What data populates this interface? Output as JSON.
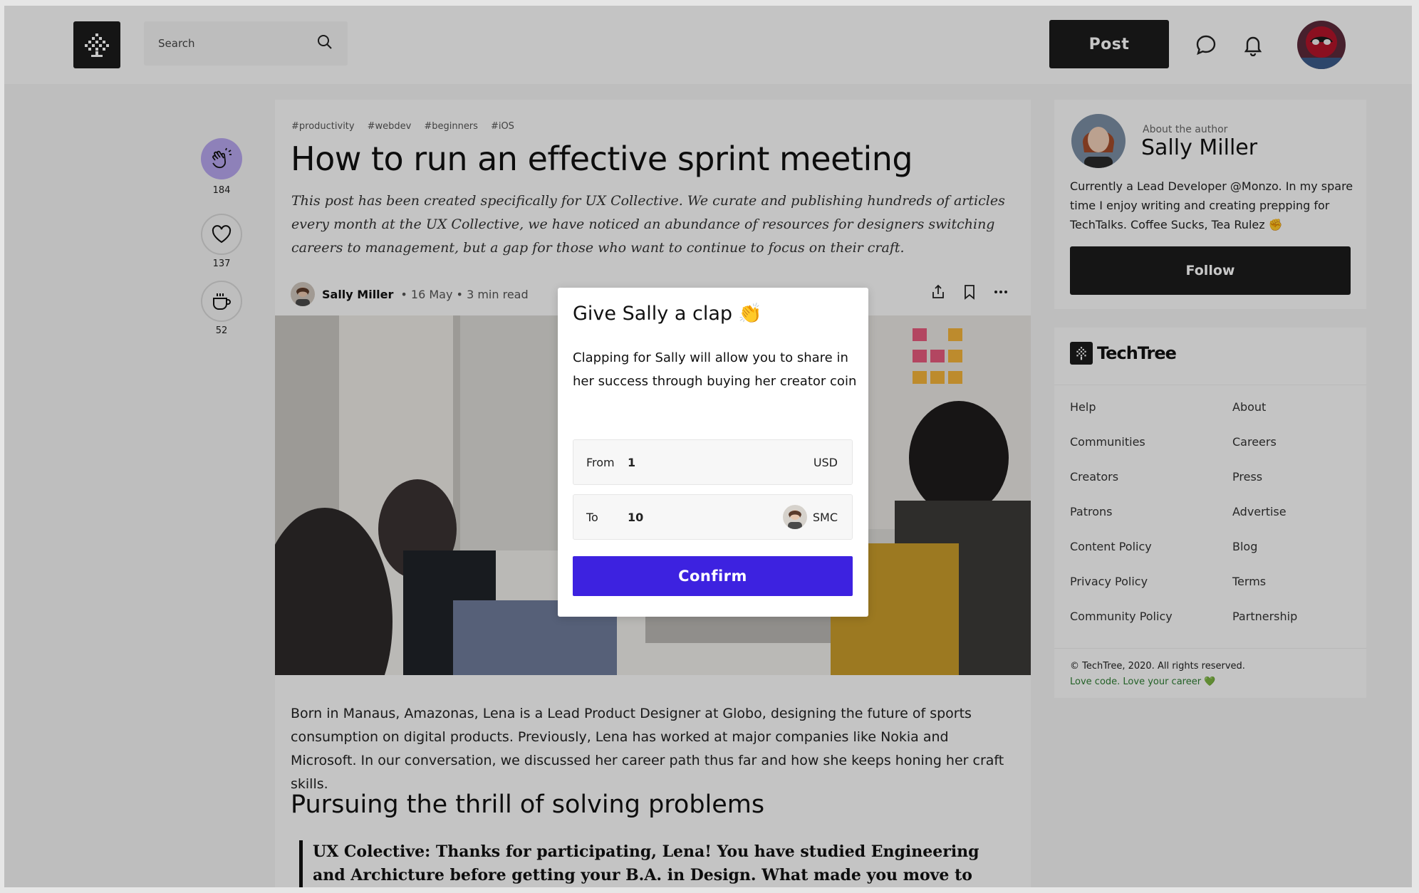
{
  "header": {
    "search_placeholder": "Search",
    "post_label": "Post",
    "icons": [
      "logo-tree-icon",
      "search-icon",
      "chat-bubble-icon",
      "bell-icon"
    ]
  },
  "rail": {
    "clap_count": "184",
    "like_count": "137",
    "coffee_count": "52"
  },
  "article": {
    "tags": [
      "#productivity",
      "#webdev",
      "#beginners",
      "#iOS"
    ],
    "title": "How to run an effective sprint meeting",
    "lede": "This post has been created specifically for UX Collective. We curate and publishing hundreds of articles every month at the UX Collective, we have noticed an abundance of resources for designers switching careers to management, but a gap for those who want to continue to focus on their craft.",
    "author": "Sally Miller",
    "meta": "• 16 May • 3 min read",
    "body": "Born in Manaus, Amazonas, Lena is a Lead Product Designer at Globo, designing the future of sports consumption on digital products. Previously, Lena has worked at major companies like Nokia and Microsoft. In our conversation, we discussed her career path thus far and how she keeps honing her craft skills.",
    "subheading": "Pursuing the thrill of solving problems",
    "quote": "UX Colective: Thanks for participating, Lena! You have studied Engineering and Archicture before getting your B.A. in Design. What made you move to design?"
  },
  "author_card": {
    "label": "About the author",
    "name": "Sally Miller",
    "bio": "Currently a Lead Developer @Monzo. In my spare time I enjoy writing and creating prepping for TechTalks. Coffee Sucks, Tea Rulez",
    "bio_emoji": "✊",
    "follow_label": "Follow"
  },
  "footer_card": {
    "brand": "TechTree",
    "links": [
      "Help",
      "About",
      "Communities",
      "Careers",
      "Creators",
      "Press",
      "Patrons",
      "Advertise",
      "Content Policy",
      "Blog",
      "Privacy Policy",
      "Terms",
      "Community Policy",
      "Partnership"
    ],
    "copyright": "© TechTree, 2020. All rights reserved.",
    "tagline": "Love code. Love your career",
    "tagline_emoji": "💚"
  },
  "modal": {
    "title": "Give Sally a clap",
    "title_emoji": "👏",
    "description": "Clapping for Sally will allow you to share in her success through buying her creator coin",
    "from_label": "From",
    "from_value": "1",
    "from_currency": "USD",
    "to_label": "To",
    "to_value": "10",
    "to_currency": "SMC",
    "confirm_label": "Confirm"
  },
  "colors": {
    "accent": "#3d22e0",
    "clap_active": "#b7a6ee",
    "dark": "#1c1c1c"
  }
}
